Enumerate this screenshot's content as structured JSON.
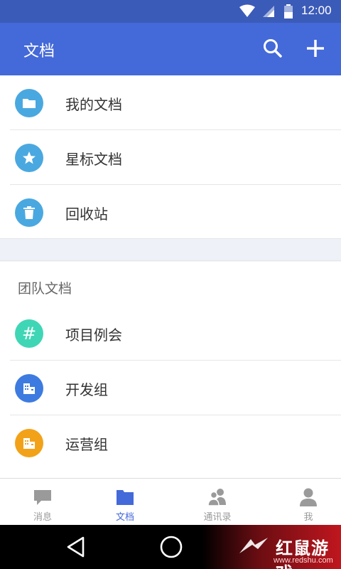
{
  "status_bar": {
    "time": "12:00"
  },
  "app_bar": {
    "title": "文档"
  },
  "personal_items": [
    {
      "label": "我的文档",
      "icon": "folder-icon",
      "color": "#4aa8e0"
    },
    {
      "label": "星标文档",
      "icon": "star-icon",
      "color": "#4aa8e0"
    },
    {
      "label": "回收站",
      "icon": "trash-icon",
      "color": "#4aa8e0"
    }
  ],
  "team_section": {
    "header": "团队文档",
    "items": [
      {
        "label": "项目例会",
        "icon": "hash-icon",
        "glyph": "#",
        "color": "#3fd6b6"
      },
      {
        "label": "开发组",
        "icon": "building-icon",
        "color": "#3d7be0"
      },
      {
        "label": "运营组",
        "icon": "building-icon",
        "color": "#f2a219"
      }
    ]
  },
  "tabs": [
    {
      "label": "消息",
      "icon": "message-icon",
      "active": false
    },
    {
      "label": "文档",
      "icon": "folder-icon",
      "active": true
    },
    {
      "label": "通讯录",
      "icon": "contacts-icon",
      "active": false
    },
    {
      "label": "我",
      "icon": "person-icon",
      "active": false
    }
  ],
  "watermark": {
    "brand": "红鼠游戏",
    "url": "www.redshu.com"
  },
  "colors": {
    "primary": "#4469d9",
    "status_bar": "#3b5bb9",
    "inactive": "#9a9a9a"
  }
}
